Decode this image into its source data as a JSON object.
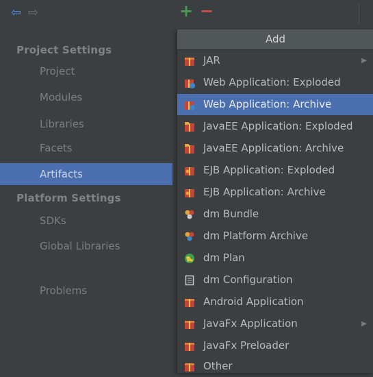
{
  "sidebar": {
    "sections": [
      {
        "header": "Project Settings"
      },
      {
        "header": "Platform Settings"
      }
    ],
    "items": [
      {
        "label": "Project"
      },
      {
        "label": "Modules"
      },
      {
        "label": "Libraries"
      },
      {
        "label": "Facets"
      },
      {
        "label": "Artifacts"
      },
      {
        "label": "SDKs"
      },
      {
        "label": "Global Libraries"
      },
      {
        "label": "Problems"
      }
    ]
  },
  "toolbar": {
    "add_symbol": "+",
    "remove_symbol": "−"
  },
  "popup": {
    "title": "Add",
    "items": [
      {
        "label": "JAR",
        "icon": "jar-icon",
        "submenu": true
      },
      {
        "label": "Web Application: Exploded",
        "icon": "web-app-icon"
      },
      {
        "label": "Web Application: Archive",
        "icon": "web-app-icon",
        "selected": true
      },
      {
        "label": "JavaEE Application: Exploded",
        "icon": "javaee-icon"
      },
      {
        "label": "JavaEE Application: Archive",
        "icon": "javaee-icon"
      },
      {
        "label": "EJB Application: Exploded",
        "icon": "ejb-icon"
      },
      {
        "label": "EJB Application: Archive",
        "icon": "ejb-icon"
      },
      {
        "label": "dm Bundle",
        "icon": "bundle-icon"
      },
      {
        "label": "dm Platform Archive",
        "icon": "bundle-icon"
      },
      {
        "label": "dm Plan",
        "icon": "globe-icon"
      },
      {
        "label": "dm Configuration",
        "icon": "document-icon"
      },
      {
        "label": "Android Application",
        "icon": "jar-icon"
      },
      {
        "label": "JavaFx Application",
        "icon": "jar-icon",
        "submenu": true
      },
      {
        "label": "JavaFx Preloader",
        "icon": "jar-icon"
      },
      {
        "label": "Other",
        "icon": "jar-icon"
      }
    ]
  },
  "colors": {
    "background": "#3c3f41",
    "selection": "#4b6eaf",
    "add": "#499c54",
    "remove": "#c75450"
  }
}
